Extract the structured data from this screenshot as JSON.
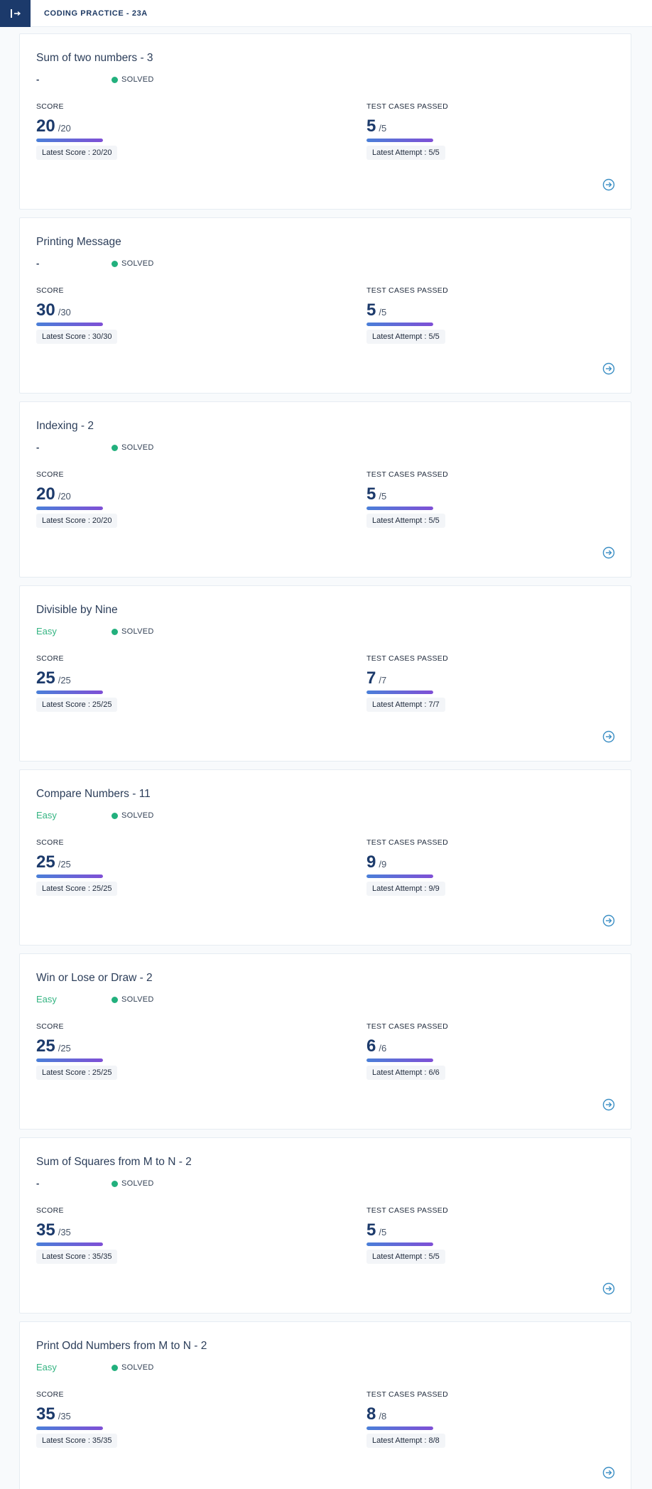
{
  "header": {
    "title": "CODING PRACTICE - 23A",
    "toggle_icon": "sidebar-collapse-icon"
  },
  "labels": {
    "score": "SCORE",
    "tests": "TEST CASES PASSED",
    "status": "SOLVED",
    "latest_score_prefix": "Latest Score : ",
    "latest_attempt_prefix": "Latest Attempt : "
  },
  "colors": {
    "brand": "#1c3a6b",
    "solved": "#22b07d",
    "easy": "#34b482"
  },
  "questions": [
    {
      "title": "Sum of two numbers - 3",
      "difficulty": "-",
      "score": "20",
      "score_total": "/20",
      "score_fraction": 1,
      "latest_score": "Latest Score : 20/20",
      "tests": "5",
      "tests_total": "/5",
      "tests_fraction": 1,
      "latest_attempt": "Latest Attempt : 5/5"
    },
    {
      "title": "Printing Message",
      "difficulty": "-",
      "score": "30",
      "score_total": "/30",
      "score_fraction": 1,
      "latest_score": "Latest Score : 30/30",
      "tests": "5",
      "tests_total": "/5",
      "tests_fraction": 1,
      "latest_attempt": "Latest Attempt : 5/5"
    },
    {
      "title": "Indexing - 2",
      "difficulty": "-",
      "score": "20",
      "score_total": "/20",
      "score_fraction": 1,
      "latest_score": "Latest Score : 20/20",
      "tests": "5",
      "tests_total": "/5",
      "tests_fraction": 1,
      "latest_attempt": "Latest Attempt : 5/5"
    },
    {
      "title": "Divisible by Nine",
      "difficulty": "Easy",
      "score": "25",
      "score_total": "/25",
      "score_fraction": 1,
      "latest_score": "Latest Score : 25/25",
      "tests": "7",
      "tests_total": "/7",
      "tests_fraction": 1,
      "latest_attempt": "Latest Attempt : 7/7"
    },
    {
      "title": "Compare Numbers - 11",
      "difficulty": "Easy",
      "score": "25",
      "score_total": "/25",
      "score_fraction": 1,
      "latest_score": "Latest Score : 25/25",
      "tests": "9",
      "tests_total": "/9",
      "tests_fraction": 1,
      "latest_attempt": "Latest Attempt : 9/9"
    },
    {
      "title": "Win or Lose or Draw - 2",
      "difficulty": "Easy",
      "score": "25",
      "score_total": "/25",
      "score_fraction": 1,
      "latest_score": "Latest Score : 25/25",
      "tests": "6",
      "tests_total": "/6",
      "tests_fraction": 1,
      "latest_attempt": "Latest Attempt : 6/6"
    },
    {
      "title": "Sum of Squares from M to N - 2",
      "difficulty": "-",
      "score": "35",
      "score_total": "/35",
      "score_fraction": 1,
      "latest_score": "Latest Score : 35/35",
      "tests": "5",
      "tests_total": "/5",
      "tests_fraction": 1,
      "latest_attempt": "Latest Attempt : 5/5"
    },
    {
      "title": "Print Odd Numbers from M to N - 2",
      "difficulty": "Easy",
      "score": "35",
      "score_total": "/35",
      "score_fraction": 1,
      "latest_score": "Latest Score : 35/35",
      "tests": "8",
      "tests_total": "/8",
      "tests_fraction": 1,
      "latest_attempt": "Latest Attempt : 8/8"
    }
  ]
}
